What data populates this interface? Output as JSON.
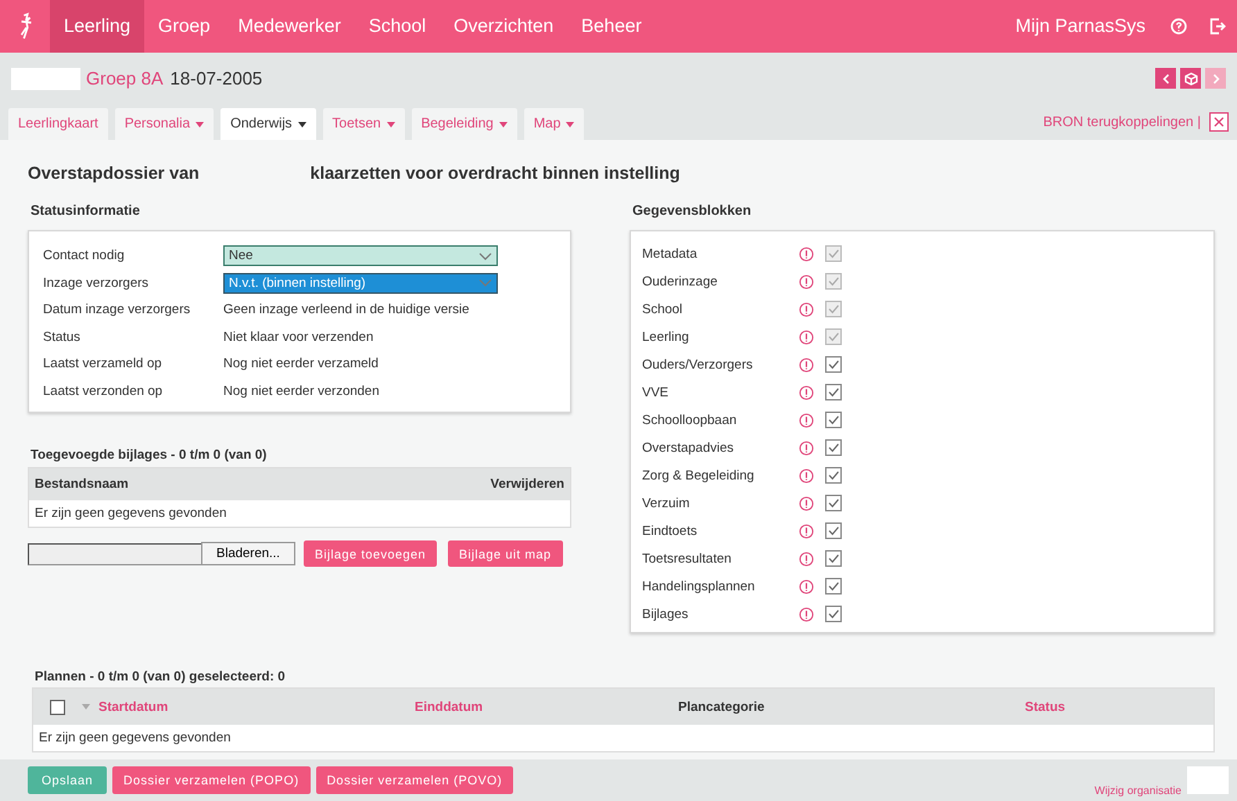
{
  "nav": {
    "items": [
      {
        "label": "Leerling",
        "selected": true
      },
      {
        "label": "Groep",
        "selected": false
      },
      {
        "label": "Medewerker",
        "selected": false
      },
      {
        "label": "School",
        "selected": false
      },
      {
        "label": "Overzichten",
        "selected": false
      },
      {
        "label": "Beheer",
        "selected": false
      }
    ],
    "user_menu": "Mijn ParnasSys"
  },
  "header": {
    "group": "Groep 8A",
    "date": "18-07-2005"
  },
  "tabs": [
    {
      "label": "Leerlingkaart",
      "dropdown": false,
      "selected": false
    },
    {
      "label": "Personalia",
      "dropdown": true,
      "selected": false
    },
    {
      "label": "Onderwijs",
      "dropdown": true,
      "selected": true
    },
    {
      "label": "Toetsen",
      "dropdown": true,
      "selected": false
    },
    {
      "label": "Begeleiding",
      "dropdown": true,
      "selected": false
    },
    {
      "label": "Map",
      "dropdown": true,
      "selected": false
    }
  ],
  "bron_link": "BRON terugkoppelingen |",
  "title_start": "Overstapdossier van",
  "title_end": "klaarzetten voor overdracht binnen instelling",
  "status": {
    "heading": "Statusinformatie",
    "rows": [
      {
        "label": "Contact nodig",
        "kind": "select",
        "value": "Nee",
        "selected": false
      },
      {
        "label": "Inzage verzorgers",
        "kind": "select",
        "value": "N.v.t. (binnen instelling)",
        "selected": true
      },
      {
        "label": "Datum inzage verzorgers",
        "kind": "text",
        "value": "Geen inzage verleend in de huidige versie"
      },
      {
        "label": "Status",
        "kind": "text",
        "value": "Niet klaar voor verzenden"
      },
      {
        "label": "Laatst verzameld op",
        "kind": "text",
        "value": "Nog niet eerder verzameld"
      },
      {
        "label": "Laatst verzonden op",
        "kind": "text",
        "value": "Nog niet eerder verzonden"
      }
    ]
  },
  "attachments": {
    "heading": "Toegevoegde bijlages - 0 t/m 0 (van 0)",
    "columns": [
      "Bestandsnaam",
      "Verwijderen"
    ],
    "empty": "Er zijn geen gegevens gevonden",
    "browse": "Bladeren...",
    "buttons": [
      "Bijlage toevoegen",
      "Bijlage uit map"
    ]
  },
  "blocks": {
    "heading": "Gegevensblokken",
    "items": [
      {
        "label": "Metadata",
        "checked": true,
        "disabled": true
      },
      {
        "label": "Ouderinzage",
        "checked": true,
        "disabled": true
      },
      {
        "label": "School",
        "checked": true,
        "disabled": true
      },
      {
        "label": "Leerling",
        "checked": true,
        "disabled": true
      },
      {
        "label": "Ouders/Verzorgers",
        "checked": true,
        "disabled": false
      },
      {
        "label": "VVE",
        "checked": true,
        "disabled": false
      },
      {
        "label": "Schoolloopbaan",
        "checked": true,
        "disabled": false
      },
      {
        "label": "Overstapadvies",
        "checked": true,
        "disabled": false
      },
      {
        "label": "Zorg & Begeleiding",
        "checked": true,
        "disabled": false
      },
      {
        "label": "Verzuim",
        "checked": true,
        "disabled": false
      },
      {
        "label": "Eindtoets",
        "checked": true,
        "disabled": false
      },
      {
        "label": "Toetsresultaten",
        "checked": true,
        "disabled": false
      },
      {
        "label": "Handelingsplannen",
        "checked": true,
        "disabled": false
      },
      {
        "label": "Bijlages",
        "checked": true,
        "disabled": false
      }
    ]
  },
  "plans": {
    "heading": "Plannen - 0 t/m 0 (van 0) geselecteerd: 0",
    "select_all": false,
    "columns": [
      {
        "label": "Startdatum",
        "sortable": true
      },
      {
        "label": "Einddatum",
        "sortable": true
      },
      {
        "label": "Plancategorie",
        "sortable": false
      },
      {
        "label": "Status",
        "sortable": true
      }
    ],
    "empty": "Er zijn geen gegevens gevonden"
  },
  "footer": {
    "buttons": [
      {
        "label": "Opslaan",
        "kind": "primary"
      },
      {
        "label": "Dossier verzamelen (POPO)",
        "kind": "secondary"
      },
      {
        "label": "Dossier verzamelen (POVO)",
        "kind": "secondary"
      }
    ],
    "link": "Wijzig organisatie"
  }
}
